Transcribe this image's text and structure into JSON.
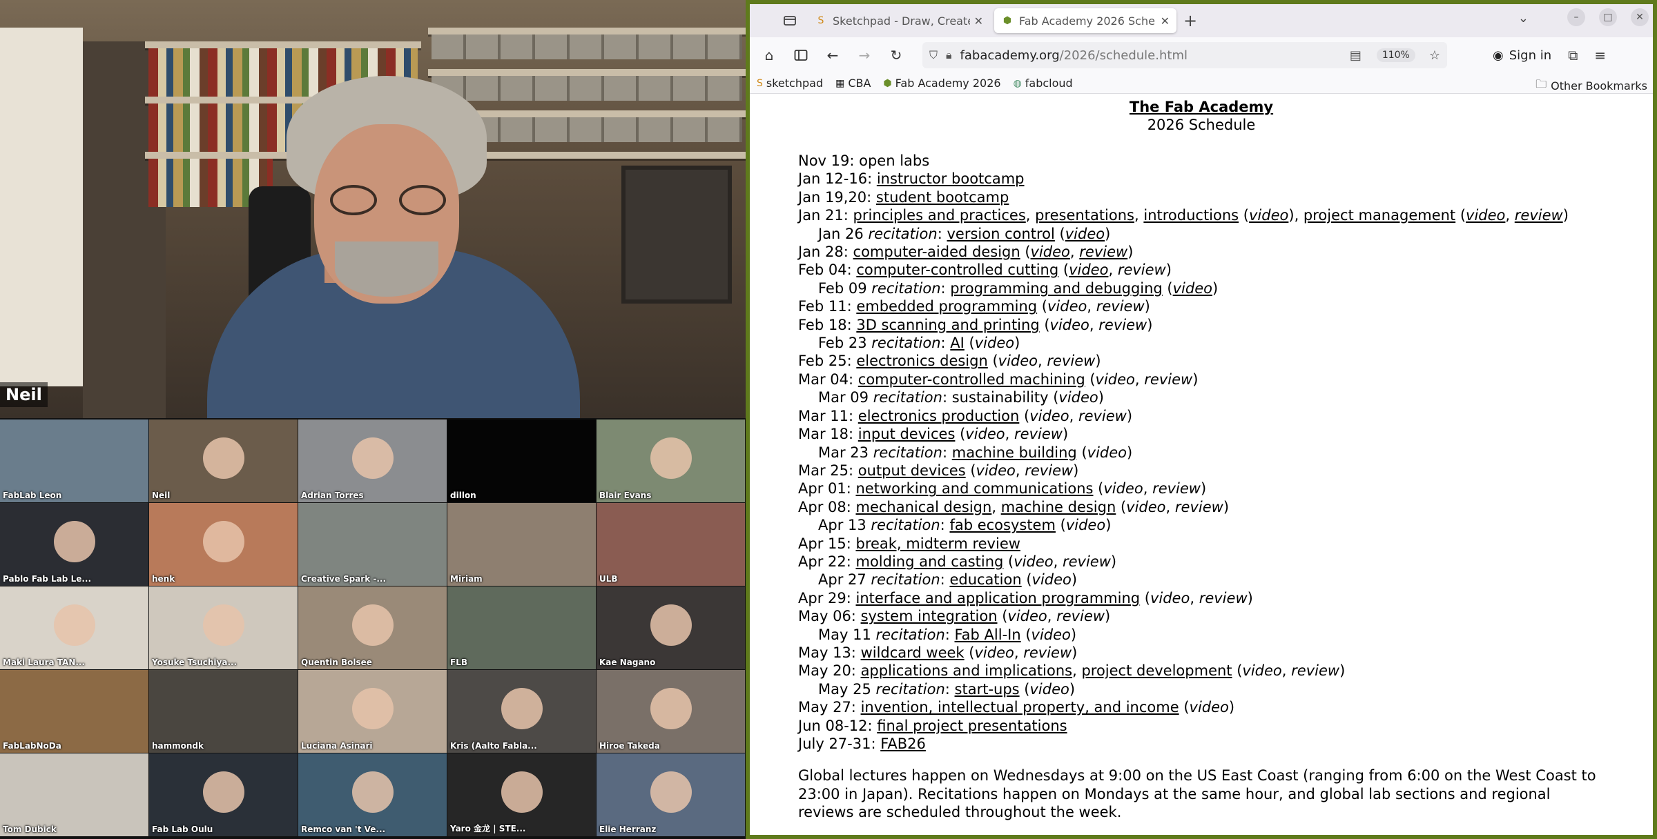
{
  "meeting": {
    "speaker_name": "Neil",
    "participants": [
      {
        "name": "FabLab Leon",
        "bg": "#6a7d8c",
        "face": false
      },
      {
        "name": "Neil",
        "bg": "#6b5c4b",
        "face": true
      },
      {
        "name": "Adrian Torres",
        "bg": "#8b8d90",
        "face": true
      },
      {
        "name": "dillon",
        "bg": "#050505",
        "face": false
      },
      {
        "name": "Blair Evans",
        "bg": "#7d8a72",
        "face": true
      },
      {
        "name": "Pablo Fab Lab Le...",
        "bg": "#2b2d33",
        "face": true
      },
      {
        "name": "henk",
        "bg": "#b87a5a",
        "face": true
      },
      {
        "name": "Creative Spark -...",
        "bg": "#7f8580",
        "face": false
      },
      {
        "name": "Miriam",
        "bg": "#8e7f70",
        "face": false
      },
      {
        "name": "ULB",
        "bg": "#8a5c52",
        "face": false
      },
      {
        "name": "Maki Laura TAN...",
        "bg": "#d9d3c9",
        "face": true
      },
      {
        "name": "Yosuke Tsuchiya...",
        "bg": "#cfc8bd",
        "face": true
      },
      {
        "name": "Quentin Bolsee",
        "bg": "#9a8a78",
        "face": true
      },
      {
        "name": "FLB",
        "bg": "#5f6a5c",
        "face": false
      },
      {
        "name": "Kae Nagano",
        "bg": "#3b3736",
        "face": true
      },
      {
        "name": "FabLabNoDa",
        "bg": "#8c6a45",
        "face": false
      },
      {
        "name": "hammondk",
        "bg": "#4a4640",
        "face": false
      },
      {
        "name": "Luciana Asinari",
        "bg": "#b7a796",
        "face": true
      },
      {
        "name": "Kris (Aalto Fabla...",
        "bg": "#4d4a47",
        "face": true
      },
      {
        "name": "Hiroe Takeda",
        "bg": "#7a7068",
        "face": true
      },
      {
        "name": "Tom Dubick",
        "bg": "#c9c4bb",
        "face": false
      },
      {
        "name": "Fab Lab Oulu",
        "bg": "#2a3038",
        "face": true
      },
      {
        "name": "Remco van 't Ve...",
        "bg": "#3f5c70",
        "face": true
      },
      {
        "name": "Yaro 金龙 | STE...",
        "bg": "#262626",
        "face": true
      },
      {
        "name": "Elie Herranz",
        "bg": "#5a6a80",
        "face": true
      }
    ]
  },
  "browser": {
    "tabs": [
      {
        "label": "Sketchpad - Draw, Create",
        "favicon": "sketchpad-favicon",
        "active": false
      },
      {
        "label": "Fab Academy 2026 Sche",
        "favicon": "fab-academy-favicon",
        "active": true
      }
    ],
    "url_host": "fabacademy.org",
    "url_path": "/2026/schedule.html",
    "zoom": "110%",
    "sign_in": "Sign in",
    "bookmarks": [
      "sketchpad",
      "CBA",
      "Fab Academy 2026",
      "fabcloud"
    ],
    "other_bookmarks": "Other Bookmarks"
  },
  "page": {
    "title": "The Fab Academy",
    "subtitle": "2026 Schedule",
    "schedule": [
      {
        "indent": false,
        "parts": [
          {
            "t": "Nov 19: open labs"
          }
        ]
      },
      {
        "indent": false,
        "parts": [
          {
            "t": "Jan 12-16: "
          },
          {
            "t": "instructor bootcamp",
            "link": true
          }
        ]
      },
      {
        "indent": false,
        "parts": [
          {
            "t": "Jan 19,20: "
          },
          {
            "t": "student bootcamp",
            "link": true
          }
        ]
      },
      {
        "indent": false,
        "parts": [
          {
            "t": "Jan 21: "
          },
          {
            "t": "principles and practices",
            "link": true
          },
          {
            "t": ", "
          },
          {
            "t": "presentations",
            "link": true
          },
          {
            "t": ", "
          },
          {
            "t": "introductions",
            "link": true
          },
          {
            "t": " ("
          },
          {
            "t": "video",
            "link": true,
            "it": true
          },
          {
            "t": "), "
          },
          {
            "t": "project management",
            "link": true
          },
          {
            "t": " ("
          },
          {
            "t": "video",
            "link": true,
            "it": true
          },
          {
            "t": ", "
          },
          {
            "t": "review",
            "link": true,
            "it": true
          },
          {
            "t": ")"
          }
        ]
      },
      {
        "indent": true,
        "parts": [
          {
            "t": "Jan 26 "
          },
          {
            "t": "recitation",
            "it": true
          },
          {
            "t": ": "
          },
          {
            "t": "version control",
            "link": true
          },
          {
            "t": " ("
          },
          {
            "t": "video",
            "link": true,
            "it": true
          },
          {
            "t": ")"
          }
        ]
      },
      {
        "indent": false,
        "parts": [
          {
            "t": "Jan 28: "
          },
          {
            "t": "computer-aided design",
            "link": true
          },
          {
            "t": " ("
          },
          {
            "t": "video",
            "link": true,
            "it": true
          },
          {
            "t": ", "
          },
          {
            "t": "review",
            "link": true,
            "it": true
          },
          {
            "t": ")"
          }
        ]
      },
      {
        "indent": false,
        "parts": [
          {
            "t": "Feb 04: "
          },
          {
            "t": "computer-controlled cutting",
            "link": true
          },
          {
            "t": " ("
          },
          {
            "t": "video",
            "link": true,
            "it": true
          },
          {
            "t": ", "
          },
          {
            "t": "review",
            "it": true
          },
          {
            "t": ")"
          }
        ]
      },
      {
        "indent": true,
        "parts": [
          {
            "t": "Feb 09 "
          },
          {
            "t": "recitation",
            "it": true
          },
          {
            "t": ": "
          },
          {
            "t": "programming and debugging",
            "link": true
          },
          {
            "t": " ("
          },
          {
            "t": "video",
            "link": true,
            "it": true
          },
          {
            "t": ")"
          }
        ]
      },
      {
        "indent": false,
        "parts": [
          {
            "t": "Feb 11: "
          },
          {
            "t": "embedded programming",
            "link": true
          },
          {
            "t": " ("
          },
          {
            "t": "video",
            "it": true
          },
          {
            "t": ", "
          },
          {
            "t": "review",
            "it": true
          },
          {
            "t": ")"
          }
        ]
      },
      {
        "indent": false,
        "parts": [
          {
            "t": "Feb 18: "
          },
          {
            "t": "3D scanning and printing",
            "link": true
          },
          {
            "t": " ("
          },
          {
            "t": "video",
            "it": true
          },
          {
            "t": ", "
          },
          {
            "t": "review",
            "it": true
          },
          {
            "t": ")"
          }
        ]
      },
      {
        "indent": true,
        "parts": [
          {
            "t": "Feb 23 "
          },
          {
            "t": "recitation",
            "it": true
          },
          {
            "t": ": "
          },
          {
            "t": "AI",
            "link": true
          },
          {
            "t": " ("
          },
          {
            "t": "video",
            "it": true
          },
          {
            "t": ")"
          }
        ]
      },
      {
        "indent": false,
        "parts": [
          {
            "t": "Feb 25: "
          },
          {
            "t": "electronics design",
            "link": true
          },
          {
            "t": " ("
          },
          {
            "t": "video",
            "it": true
          },
          {
            "t": ", "
          },
          {
            "t": "review",
            "it": true
          },
          {
            "t": ")"
          }
        ]
      },
      {
        "indent": false,
        "parts": [
          {
            "t": "Mar 04: "
          },
          {
            "t": "computer-controlled machining",
            "link": true
          },
          {
            "t": " ("
          },
          {
            "t": "video",
            "it": true
          },
          {
            "t": ", "
          },
          {
            "t": "review",
            "it": true
          },
          {
            "t": ")"
          }
        ]
      },
      {
        "indent": true,
        "parts": [
          {
            "t": "Mar 09 "
          },
          {
            "t": "recitation",
            "it": true
          },
          {
            "t": ": sustainability ("
          },
          {
            "t": "video",
            "it": true
          },
          {
            "t": ")"
          }
        ]
      },
      {
        "indent": false,
        "parts": [
          {
            "t": "Mar 11: "
          },
          {
            "t": "electronics production",
            "link": true
          },
          {
            "t": " ("
          },
          {
            "t": "video",
            "it": true
          },
          {
            "t": ", "
          },
          {
            "t": "review",
            "it": true
          },
          {
            "t": ")"
          }
        ]
      },
      {
        "indent": false,
        "parts": [
          {
            "t": "Mar 18: "
          },
          {
            "t": "input devices",
            "link": true
          },
          {
            "t": " ("
          },
          {
            "t": "video",
            "it": true
          },
          {
            "t": ", "
          },
          {
            "t": "review",
            "it": true
          },
          {
            "t": ")"
          }
        ]
      },
      {
        "indent": true,
        "parts": [
          {
            "t": "Mar 23 "
          },
          {
            "t": "recitation",
            "it": true
          },
          {
            "t": ": "
          },
          {
            "t": "machine building",
            "link": true
          },
          {
            "t": " ("
          },
          {
            "t": "video",
            "it": true
          },
          {
            "t": ")"
          }
        ]
      },
      {
        "indent": false,
        "parts": [
          {
            "t": "Mar 25: "
          },
          {
            "t": "output devices",
            "link": true
          },
          {
            "t": " ("
          },
          {
            "t": "video",
            "it": true
          },
          {
            "t": ", "
          },
          {
            "t": "review",
            "it": true
          },
          {
            "t": ")"
          }
        ]
      },
      {
        "indent": false,
        "parts": [
          {
            "t": "Apr 01: "
          },
          {
            "t": "networking and communications",
            "link": true
          },
          {
            "t": " ("
          },
          {
            "t": "video",
            "it": true
          },
          {
            "t": ", "
          },
          {
            "t": "review",
            "it": true
          },
          {
            "t": ")"
          }
        ]
      },
      {
        "indent": false,
        "parts": [
          {
            "t": "Apr 08: "
          },
          {
            "t": "mechanical design",
            "link": true
          },
          {
            "t": ", "
          },
          {
            "t": "machine design",
            "link": true
          },
          {
            "t": " ("
          },
          {
            "t": "video",
            "it": true
          },
          {
            "t": ", "
          },
          {
            "t": "review",
            "it": true
          },
          {
            "t": ")"
          }
        ]
      },
      {
        "indent": true,
        "parts": [
          {
            "t": "Apr 13 "
          },
          {
            "t": "recitation",
            "it": true
          },
          {
            "t": ": "
          },
          {
            "t": "fab ecosystem",
            "link": true
          },
          {
            "t": " ("
          },
          {
            "t": "video",
            "it": true
          },
          {
            "t": ")"
          }
        ]
      },
      {
        "indent": false,
        "parts": [
          {
            "t": "Apr 15: "
          },
          {
            "t": "break, midterm review",
            "link": true
          }
        ]
      },
      {
        "indent": false,
        "parts": [
          {
            "t": "Apr 22: "
          },
          {
            "t": "molding and casting",
            "link": true
          },
          {
            "t": " ("
          },
          {
            "t": "video",
            "it": true
          },
          {
            "t": ", "
          },
          {
            "t": "review",
            "it": true
          },
          {
            "t": ")"
          }
        ]
      },
      {
        "indent": true,
        "parts": [
          {
            "t": "Apr 27 "
          },
          {
            "t": "recitation",
            "it": true
          },
          {
            "t": ": "
          },
          {
            "t": "education",
            "link": true
          },
          {
            "t": " ("
          },
          {
            "t": "video",
            "it": true
          },
          {
            "t": ")"
          }
        ]
      },
      {
        "indent": false,
        "parts": [
          {
            "t": "Apr 29: "
          },
          {
            "t": "interface and application programming",
            "link": true
          },
          {
            "t": " ("
          },
          {
            "t": "video",
            "it": true
          },
          {
            "t": ", "
          },
          {
            "t": "review",
            "it": true
          },
          {
            "t": ")"
          }
        ]
      },
      {
        "indent": false,
        "parts": [
          {
            "t": "May 06: "
          },
          {
            "t": "system integration",
            "link": true
          },
          {
            "t": " ("
          },
          {
            "t": "video",
            "it": true
          },
          {
            "t": ", "
          },
          {
            "t": "review",
            "it": true
          },
          {
            "t": ")"
          }
        ]
      },
      {
        "indent": true,
        "parts": [
          {
            "t": "May 11 "
          },
          {
            "t": "recitation",
            "it": true
          },
          {
            "t": ": "
          },
          {
            "t": "Fab All-In",
            "link": true
          },
          {
            "t": " ("
          },
          {
            "t": "video",
            "it": true
          },
          {
            "t": ")"
          }
        ]
      },
      {
        "indent": false,
        "parts": [
          {
            "t": "May 13: "
          },
          {
            "t": "wildcard week",
            "link": true
          },
          {
            "t": " ("
          },
          {
            "t": "video",
            "it": true
          },
          {
            "t": ", "
          },
          {
            "t": "review",
            "it": true
          },
          {
            "t": ")"
          }
        ]
      },
      {
        "indent": false,
        "parts": [
          {
            "t": "May 20: "
          },
          {
            "t": "applications and implications",
            "link": true
          },
          {
            "t": ", "
          },
          {
            "t": "project development",
            "link": true
          },
          {
            "t": " ("
          },
          {
            "t": "video",
            "it": true
          },
          {
            "t": ", "
          },
          {
            "t": "review",
            "it": true
          },
          {
            "t": ")"
          }
        ]
      },
      {
        "indent": true,
        "parts": [
          {
            "t": "May 25 "
          },
          {
            "t": "recitation",
            "it": true
          },
          {
            "t": ": "
          },
          {
            "t": "start-ups",
            "link": true
          },
          {
            "t": " ("
          },
          {
            "t": "video",
            "it": true
          },
          {
            "t": ")"
          }
        ]
      },
      {
        "indent": false,
        "parts": [
          {
            "t": "May 27: "
          },
          {
            "t": "invention, intellectual property, and income",
            "link": true
          },
          {
            "t": " ("
          },
          {
            "t": "video",
            "it": true
          },
          {
            "t": ")"
          }
        ]
      },
      {
        "indent": false,
        "parts": [
          {
            "t": "Jun 08-12: "
          },
          {
            "t": "final project presentations",
            "link": true
          }
        ]
      },
      {
        "indent": false,
        "parts": [
          {
            "t": "July 27-31: "
          },
          {
            "t": "FAB26",
            "link": true
          }
        ]
      }
    ],
    "footer": "Global lectures happen on Wednesdays at 9:00 on the US East Coast (ranging from 6:00 on the West Coast to 23:00 in Japan). Recitations happen on Mondays at the same hour, and global lab sections and regional reviews are scheduled throughout the week."
  },
  "colors": {
    "browser_frame": "#5f7a1c",
    "tab_bar": "#eceaf0"
  }
}
